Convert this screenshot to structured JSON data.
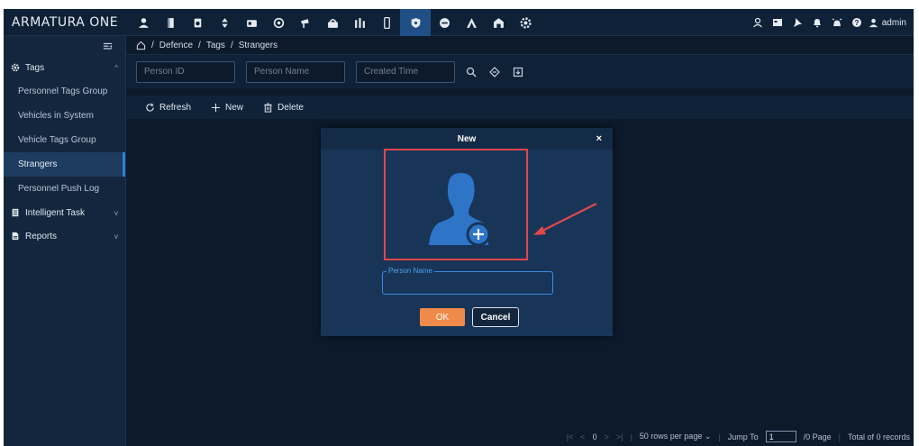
{
  "app": {
    "title": "ARMATURA ONE"
  },
  "topnav": {
    "icons": [
      "personnel-icon",
      "door-icon",
      "timer-icon",
      "elevator-icon",
      "card-icon",
      "location-icon",
      "camera-icon",
      "intercom-icon",
      "building-icon",
      "phone-icon",
      "shield-icon",
      "vehicle-icon",
      "armatura-icon",
      "warehouse-icon",
      "settings-icon"
    ],
    "active": "shield-icon",
    "right_icons": [
      "user-group-icon",
      "screen-icon",
      "pin-icon",
      "bell-icon",
      "alarm-icon",
      "help-icon"
    ],
    "user": "admin"
  },
  "sidebar": {
    "groups": [
      {
        "label": "Tags",
        "expanded": true
      },
      {
        "label": "Intelligent Task",
        "expanded": false
      },
      {
        "label": "Reports",
        "expanded": false
      }
    ],
    "items": [
      "Personnel Tags Group",
      "Vehicles in System",
      "Vehicle Tags Group",
      "Strangers",
      "Personnel Push Log"
    ],
    "active_item": "Strangers"
  },
  "breadcrumb": [
    "Defence",
    "Tags",
    "Strangers"
  ],
  "filters": {
    "person_id_placeholder": "Person ID",
    "person_name_placeholder": "Person Name",
    "created_time_placeholder": "Created Time"
  },
  "toolbar": {
    "refresh": "Refresh",
    "new": "New",
    "delete": "Delete"
  },
  "pager": {
    "current": "0",
    "rows_per_page": "50 rows per page",
    "jump_to": "Jump To",
    "jump_value": "1",
    "pages": "/0 Page",
    "total": "Total of 0 records"
  },
  "modal": {
    "title": "New",
    "close": "×",
    "person_name_label": "Person Name",
    "ok": "OK",
    "cancel": "Cancel"
  },
  "colors": {
    "accent": "#2f7fd1",
    "ok": "#f08a4b",
    "highlight": "#e0474b",
    "background": "#0c1a2c"
  }
}
